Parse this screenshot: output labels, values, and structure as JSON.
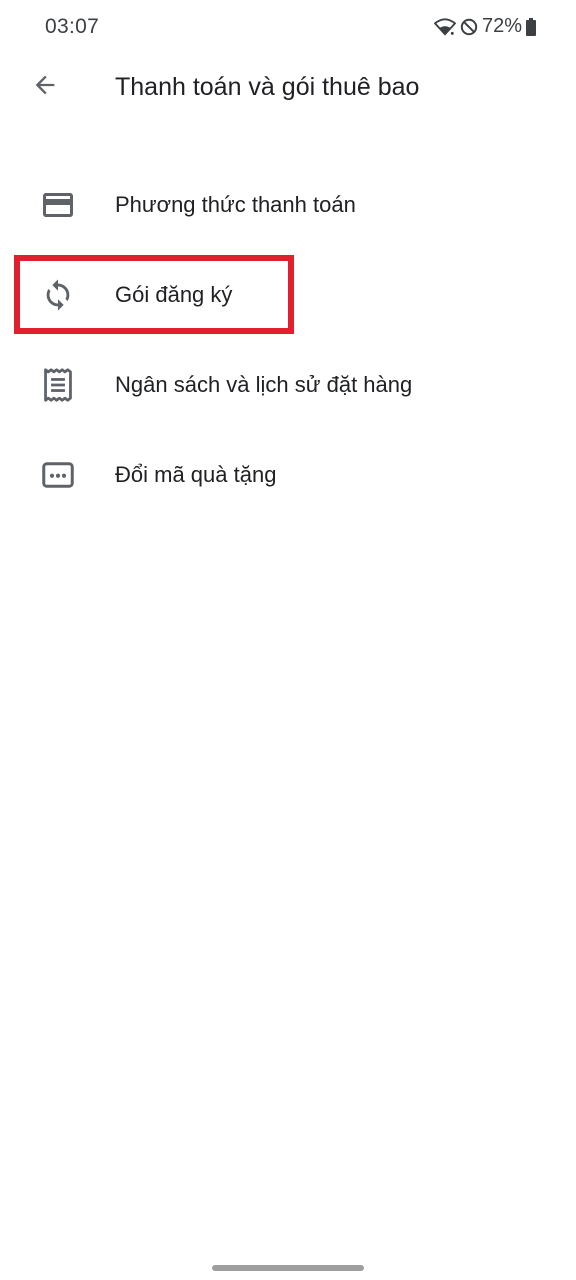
{
  "status_bar": {
    "time": "03:07",
    "battery": "72%"
  },
  "header": {
    "title": "Thanh toán và gói thuê bao"
  },
  "menu": {
    "items": [
      {
        "label": "Phương thức thanh toán",
        "icon": "credit-card-icon"
      },
      {
        "label": "Gói đăng ký",
        "icon": "refresh-icon"
      },
      {
        "label": "Ngân sách và lịch sử đặt hàng",
        "icon": "receipt-icon"
      },
      {
        "label": "Đổi mã quà tặng",
        "icon": "redeem-code-icon"
      }
    ]
  },
  "colors": {
    "icon": "#5f6368",
    "highlight": "#e0202c",
    "text": "#202124"
  }
}
